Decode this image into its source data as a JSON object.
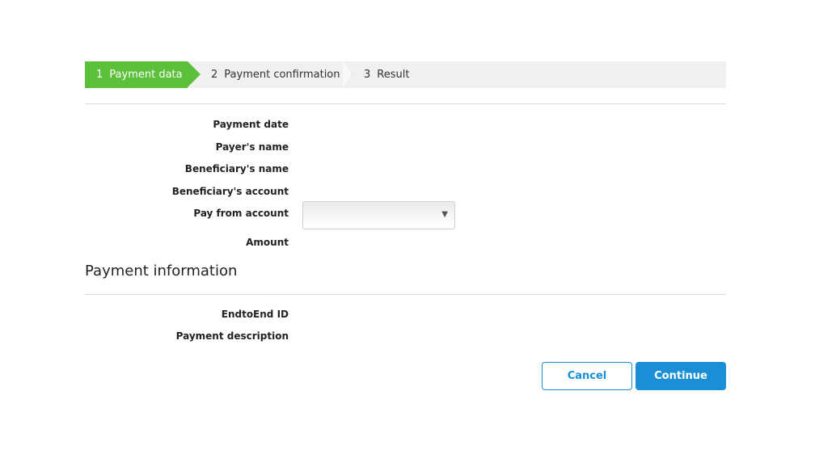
{
  "stepper": {
    "steps": [
      {
        "number": "1",
        "label": "Payment data",
        "active": true
      },
      {
        "number": "2",
        "label": "Payment confirmation",
        "active": false
      },
      {
        "number": "3",
        "label": "Result",
        "active": false
      }
    ]
  },
  "form": {
    "payment_date_label": "Payment date",
    "payer_name_label": "Payer's name",
    "beneficiary_name_label": "Beneficiary's name",
    "beneficiary_account_label": "Beneficiary's account",
    "pay_from_account_label": "Pay from account",
    "pay_from_account_value": "",
    "amount_label": "Amount"
  },
  "payment_information": {
    "title": "Payment information",
    "endtoend_label": "EndtoEnd ID",
    "description_label": "Payment description"
  },
  "actions": {
    "cancel_label": "Cancel",
    "continue_label": "Continue"
  },
  "colors": {
    "active_step": "#5cc03a",
    "primary": "#1a8fd6",
    "stepper_bg": "#f0f0f0"
  },
  "icons": {
    "dropdown": "chevron-down-icon"
  }
}
